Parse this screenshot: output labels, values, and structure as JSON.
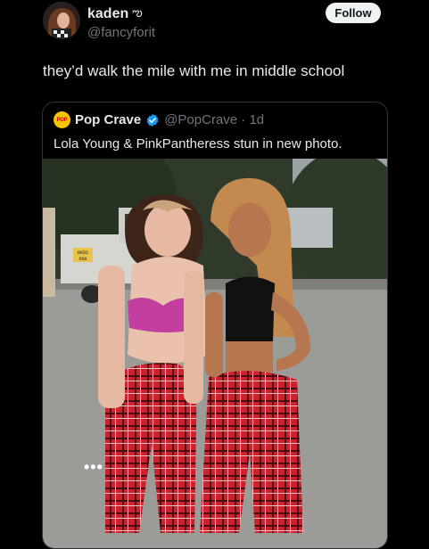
{
  "author": {
    "name": "kaden",
    "name_emoji": "ఌ︎",
    "handle": "@fancyforit",
    "follow_label": "Follow"
  },
  "tweet": {
    "text": "they’d walk the mile with me in middle school"
  },
  "quoted": {
    "logo_text": "POP",
    "name": "Pop Crave",
    "handle_time": "@PopCrave · 1d",
    "text": "Lola Young & PinkPantheress stun in new photo.",
    "plate_text": [
      "RKDS",
      "OOH"
    ],
    "more_icon": "•••"
  },
  "colors": {
    "background": "#000000",
    "text": "#e7e9ea",
    "muted": "#71767b",
    "verified": "#1d9bf0",
    "follow_bg": "#eff3f4"
  },
  "icons": [
    "verified-badge-icon",
    "more-options-icon",
    "avatar-image",
    "pop-crave-logo-icon"
  ]
}
